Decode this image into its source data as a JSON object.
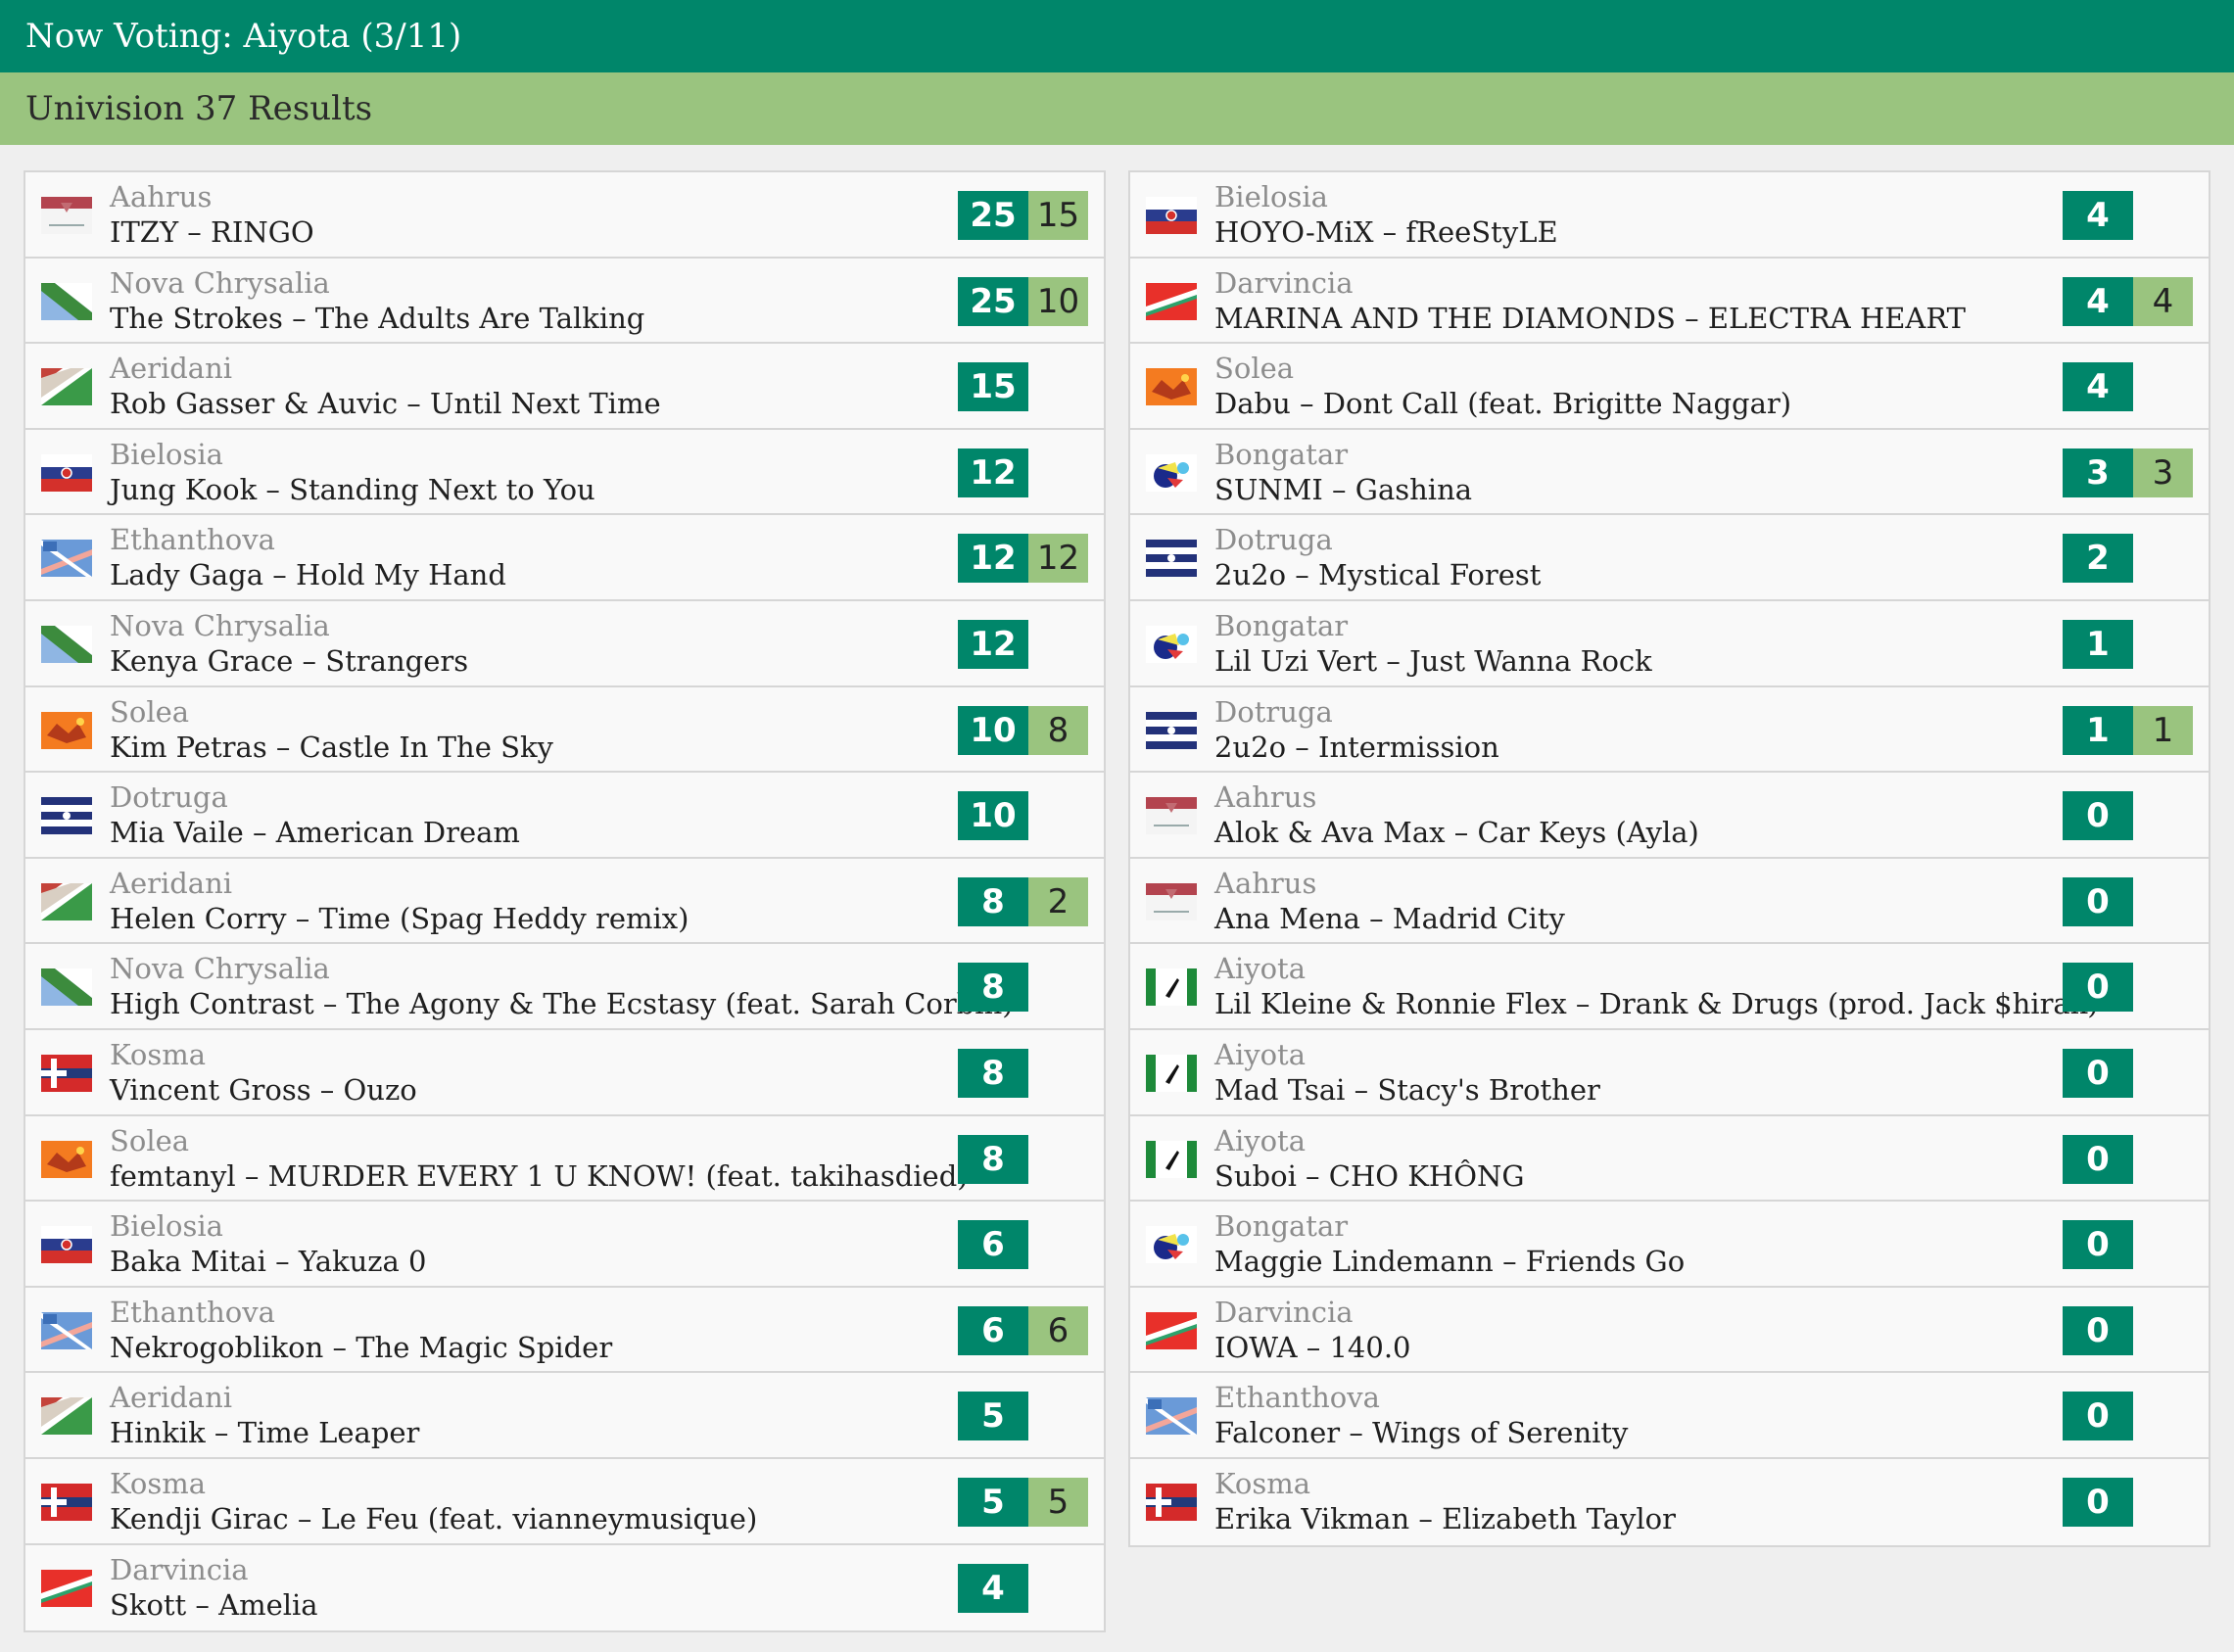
{
  "header": {
    "title": "Now Voting: Aiyota (3/11)",
    "subtitle": "Univision 37 Results"
  },
  "colors": {
    "header_green": "#00866a",
    "sub_green": "#9ac47f"
  },
  "results_left": [
    {
      "country": "Aahrus",
      "flag": "aahrus-flag",
      "artist": "ITZY",
      "title": "RINGO",
      "points": "25",
      "jury": "15"
    },
    {
      "country": "Nova Chrysalia",
      "flag": "nova-chrysalia-flag",
      "artist": "The Strokes",
      "title": "The Adults Are Talking",
      "points": "25",
      "jury": "10"
    },
    {
      "country": "Aeridani",
      "flag": "aeridani-flag",
      "artist": "Rob Gasser & Auvic",
      "title": "Until Next Time",
      "points": "15",
      "jury": ""
    },
    {
      "country": "Bielosia",
      "flag": "bielosia-flag",
      "artist": "Jung Kook",
      "title": "Standing Next to You",
      "points": "12",
      "jury": ""
    },
    {
      "country": "Ethanthova",
      "flag": "ethanthova-flag",
      "artist": "Lady Gaga",
      "title": "Hold My Hand",
      "points": "12",
      "jury": "12"
    },
    {
      "country": "Nova Chrysalia",
      "flag": "nova-chrysalia-flag",
      "artist": "Kenya Grace",
      "title": "Strangers",
      "points": "12",
      "jury": ""
    },
    {
      "country": "Solea",
      "flag": "solea-flag",
      "artist": "Kim Petras",
      "title": "Castle In The Sky",
      "points": "10",
      "jury": "8"
    },
    {
      "country": "Dotruga",
      "flag": "dotruga-flag",
      "artist": "Mia Vaile",
      "title": "American Dream",
      "points": "10",
      "jury": ""
    },
    {
      "country": "Aeridani",
      "flag": "aeridani-flag",
      "artist": "Helen Corry",
      "title": "Time (Spag Heddy remix)",
      "points": "8",
      "jury": "2"
    },
    {
      "country": "Nova Chrysalia",
      "flag": "nova-chrysalia-flag",
      "artist": "High Contrast",
      "title": "The Agony & The Ecstasy (feat. Sarah Corbin)",
      "points": "8",
      "jury": ""
    },
    {
      "country": "Kosma",
      "flag": "kosma-flag",
      "artist": "Vincent Gross",
      "title": "Ouzo",
      "points": "8",
      "jury": ""
    },
    {
      "country": "Solea",
      "flag": "solea-flag",
      "artist": "femtanyl",
      "title": "MURDER EVERY 1 U KNOW! (feat. takihasdied)",
      "points": "8",
      "jury": ""
    },
    {
      "country": "Bielosia",
      "flag": "bielosia-flag",
      "artist": "Baka Mitai",
      "title": "Yakuza 0",
      "points": "6",
      "jury": ""
    },
    {
      "country": "Ethanthova",
      "flag": "ethanthova-flag",
      "artist": "Nekrogoblikon",
      "title": "The Magic Spider",
      "points": "6",
      "jury": "6"
    },
    {
      "country": "Aeridani",
      "flag": "aeridani-flag",
      "artist": "Hinkik",
      "title": "Time Leaper",
      "points": "5",
      "jury": ""
    },
    {
      "country": "Kosma",
      "flag": "kosma-flag",
      "artist": "Kendji Girac",
      "title": "Le Feu (feat. vianneymusique)",
      "points": "5",
      "jury": "5"
    },
    {
      "country": "Darvincia",
      "flag": "darvincia-flag",
      "artist": "Skott",
      "title": "Amelia",
      "points": "4",
      "jury": ""
    }
  ],
  "results_right": [
    {
      "country": "Bielosia",
      "flag": "bielosia-flag",
      "artist": "HOYO-MiX",
      "title": "fReeStyLE",
      "points": "4",
      "jury": ""
    },
    {
      "country": "Darvincia",
      "flag": "darvincia-flag",
      "artist": "MARINA AND THE DIAMONDS",
      "title": "ELECTRA HEART",
      "points": "4",
      "jury": "4"
    },
    {
      "country": "Solea",
      "flag": "solea-flag",
      "artist": "Dabu",
      "title": "Dont Call (feat. Brigitte Naggar)",
      "points": "4",
      "jury": ""
    },
    {
      "country": "Bongatar",
      "flag": "bongatar-flag",
      "artist": "SUNMI",
      "title": "Gashina",
      "points": "3",
      "jury": "3"
    },
    {
      "country": "Dotruga",
      "flag": "dotruga-flag",
      "artist": "2u2o",
      "title": "Mystical Forest",
      "points": "2",
      "jury": ""
    },
    {
      "country": "Bongatar",
      "flag": "bongatar-flag",
      "artist": "Lil Uzi Vert",
      "title": "Just Wanna Rock",
      "points": "1",
      "jury": ""
    },
    {
      "country": "Dotruga",
      "flag": "dotruga-flag",
      "artist": "2u2o",
      "title": "Intermission",
      "points": "1",
      "jury": "1"
    },
    {
      "country": "Aahrus",
      "flag": "aahrus-flag",
      "artist": "Alok & Ava Max",
      "title": "Car Keys (Ayla)",
      "points": "0",
      "jury": ""
    },
    {
      "country": "Aahrus",
      "flag": "aahrus-flag",
      "artist": "Ana Mena",
      "title": "Madrid City",
      "points": "0",
      "jury": ""
    },
    {
      "country": "Aiyota",
      "flag": "aiyota-flag",
      "artist": "Lil Kleine & Ronnie Flex",
      "title": "Drank & Drugs (prod. Jack $hirak)",
      "points": "0",
      "jury": ""
    },
    {
      "country": "Aiyota",
      "flag": "aiyota-flag",
      "artist": "Mad Tsai",
      "title": "Stacy's Brother",
      "points": "0",
      "jury": ""
    },
    {
      "country": "Aiyota",
      "flag": "aiyota-flag",
      "artist": "Suboi",
      "title": "CHO KHÔNG",
      "points": "0",
      "jury": ""
    },
    {
      "country": "Bongatar",
      "flag": "bongatar-flag",
      "artist": "Maggie Lindemann",
      "title": "Friends Go",
      "points": "0",
      "jury": ""
    },
    {
      "country": "Darvincia",
      "flag": "darvincia-flag",
      "artist": "IOWA",
      "title": "140.0",
      "points": "0",
      "jury": ""
    },
    {
      "country": "Ethanthova",
      "flag": "ethanthova-flag",
      "artist": "Falconer",
      "title": "Wings of Serenity",
      "points": "0",
      "jury": ""
    },
    {
      "country": "Kosma",
      "flag": "kosma-flag",
      "artist": "Erika Vikman",
      "title": "Elizabeth Taylor",
      "points": "0",
      "jury": ""
    }
  ]
}
